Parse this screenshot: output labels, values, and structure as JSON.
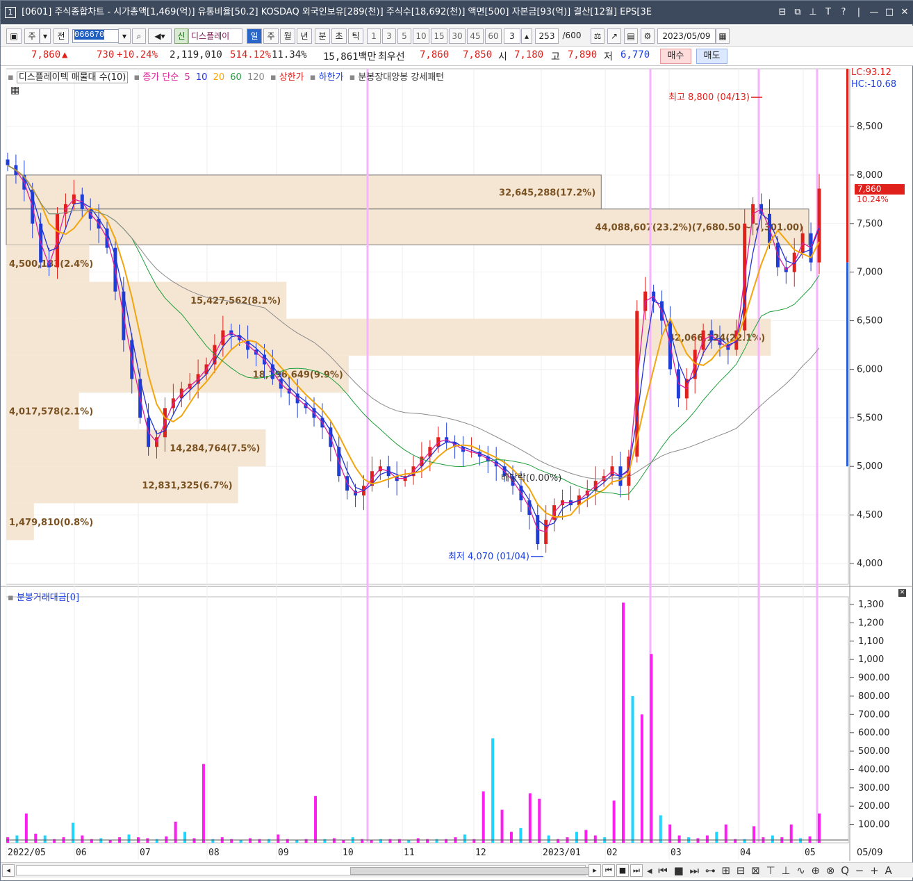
{
  "window": {
    "num": "1",
    "title": "[0601] 주식종합차트 - 시가총액[1,469(억)] 유통비율[50.2] KOSDAQ 외국인보유[289(천)] 주식수[18,692(천)] 액면[500] 자본금[93(억)] 결산[12월] EPS[3E",
    "buttons": [
      "⊟",
      "⧉",
      "⊥",
      "T",
      "?",
      "|",
      "—",
      "□",
      "✕"
    ]
  },
  "toolbar": {
    "code": "066670",
    "mode_btns": [
      "주",
      "전"
    ],
    "name": "디스플레이",
    "new_badge": "신",
    "periods": [
      "일",
      "주",
      "월",
      "년",
      "분",
      "초",
      "틱"
    ],
    "period_selected": "일",
    "intervals": [
      "1",
      "3",
      "5",
      "10",
      "15",
      "30",
      "45",
      "60"
    ],
    "interval_value": "3",
    "count": "253",
    "count_max": "/600",
    "date": "2023/05/09"
  },
  "quote": {
    "price": "7,860",
    "arrow": "▲",
    "change": "730",
    "change_pct": "+10.24%",
    "volume": "2,119,010",
    "vol_ratio": "514.12%",
    "turnover": "11.34%",
    "trade_value": "15,861백만",
    "best_ask_label": "최우선",
    "best_ask": "7,860",
    "best_bid": "7,850",
    "open_label": "시",
    "open": "7,180",
    "high_label": "고",
    "high": "7,890",
    "low_label": "저",
    "low": "6,770",
    "buy": "매수",
    "sell": "매도"
  },
  "legend_price": {
    "name": "디스플레이텍 매물대 수(10)",
    "ma_label": "종가 단순",
    "ma5": "5",
    "ma10": "10",
    "ma20": "20",
    "ma60": "60",
    "ma120": "120",
    "upper_limit": "상한가",
    "lower_limit": "하한가",
    "pattern": "분봉장대양봉 강세패턴"
  },
  "legend_vol": "분봉거래대금[0]",
  "lc": "LC:93.12",
  "hc": "HC:-10.68",
  "cur_price_badge": "7,860",
  "cur_pct": "10.24%",
  "annotations": {
    "high": "최고 8,800 (04/13)",
    "low": "최저 4,070 (01/04)",
    "dividend": "배당락(0.00%)"
  },
  "chart_data": {
    "type": "candlestick",
    "price_axis": {
      "ticks": [
        "8,500",
        "8,000",
        "7,500",
        "7,000",
        "6,500",
        "6,000",
        "5,500",
        "5,000",
        "4,500",
        "4,000"
      ],
      "ylim": [
        3800,
        9500
      ]
    },
    "volume_axis": {
      "ticks": [
        "1,300",
        "1,200",
        "1,100",
        "1,000",
        "900.00",
        "800.00",
        "700.00",
        "600.00",
        "500.00",
        "400.00",
        "300.00",
        "200.00",
        "100.00"
      ],
      "ylim": [
        0,
        1400
      ]
    },
    "x_labels": [
      "2022/05",
      "06",
      "07",
      "08",
      "09",
      "10",
      "11",
      "12",
      "2023/01",
      "02",
      "03",
      "04",
      "05"
    ],
    "last_date_label": "05/09",
    "volume_profile": [
      {
        "label": "32,645,288(17.2%)",
        "price_low": 7650,
        "price_high": 8000,
        "pct": 17.2
      },
      {
        "label": "44,088,607(23.2%)(7,680.50 ~ 7,301.00)",
        "price_low": 7280,
        "price_high": 7650,
        "pct": 23.2
      },
      {
        "label": "4,500,183(2.4%)",
        "price_low": 6900,
        "price_high": 7280,
        "pct": 2.4
      },
      {
        "label": "15,427,562(8.1%)",
        "price_low": 6520,
        "price_high": 6900,
        "pct": 8.1
      },
      {
        "label": "42,066,124(22.1%)",
        "price_low": 6140,
        "price_high": 6520,
        "pct": 22.1
      },
      {
        "label": "18,796,649(9.9%)",
        "price_low": 5760,
        "price_high": 6140,
        "pct": 9.9
      },
      {
        "label": "4,017,578(2.1%)",
        "price_low": 5380,
        "price_high": 5760,
        "pct": 2.1
      },
      {
        "label": "14,284,764(7.5%)",
        "price_low": 5000,
        "price_high": 5380,
        "pct": 7.5
      },
      {
        "label": "12,831,325(6.7%)",
        "price_low": 4620,
        "price_high": 5000,
        "pct": 6.7
      },
      {
        "label": "1,479,810(0.8%)",
        "price_low": 4240,
        "price_high": 4620,
        "pct": 0.8
      }
    ],
    "colors": {
      "up": "#e0201b",
      "down": "#1f3ed8",
      "ma5": "#e0209a",
      "ma10": "#2433d6",
      "ma20": "#f2a50c",
      "ma60": "#1e9e3a",
      "ma120": "#8a8a8a",
      "profile": "#f5e6d3",
      "vol_up": "#ff1ef2",
      "vol_down": "#1fd5ff",
      "vline": "#f6b3ff"
    },
    "close_path": [
      8100,
      8000,
      7850,
      7500,
      7100,
      7050,
      7600,
      7700,
      7800,
      7650,
      7550,
      7450,
      7250,
      6800,
      6300,
      5900,
      5500,
      5200,
      5300,
      5600,
      5700,
      5800,
      5850,
      5950,
      6050,
      6250,
      6400,
      6350,
      6300,
      6200,
      6150,
      6050,
      5900,
      5800,
      5750,
      5650,
      5600,
      5500,
      5400,
      5200,
      4900,
      4750,
      4700,
      4800,
      4950,
      5000,
      4900,
      4850,
      4900,
      5000,
      5100,
      5200,
      5300,
      5250,
      5200,
      5150,
      5150,
      5100,
      5050,
      5000,
      4900,
      4800,
      4650,
      4500,
      4200,
      4450,
      4600,
      4650,
      4600,
      4700,
      4750,
      4850,
      4900,
      5000,
      4800,
      5100,
      6600,
      6800,
      6700,
      6500,
      6000,
      5700,
      5900,
      6200,
      6400,
      6300,
      6250,
      6200,
      6400,
      7500,
      7700,
      7600,
      7300,
      7050,
      7000,
      7200,
      7400,
      7100,
      7860
    ],
    "volume_path": [
      30,
      40,
      160,
      50,
      40,
      20,
      30,
      110,
      40,
      20,
      25,
      15,
      30,
      45,
      30,
      25,
      20,
      35,
      115,
      60,
      25,
      430,
      20,
      30,
      20,
      15,
      25,
      20,
      20,
      45,
      20,
      15,
      20,
      255,
      20,
      25,
      15,
      30,
      20,
      15,
      20,
      20,
      20,
      15,
      25,
      20,
      20,
      20,
      30,
      45,
      20,
      280,
      570,
      180,
      60,
      80,
      270,
      240,
      40,
      20,
      30,
      60,
      70,
      40,
      30,
      230,
      1310,
      800,
      700,
      1030,
      150,
      100,
      40,
      30,
      25,
      40,
      60,
      100,
      20,
      20,
      90,
      30,
      40,
      30,
      100,
      25,
      35,
      160
    ]
  },
  "bottom_icons": "◂ ⏮ ■ ⏭ ⊶ ⊞ ⊟ ⊠ ⊤ ⊥ ∿ ⊕ ⊗ Q − + A"
}
